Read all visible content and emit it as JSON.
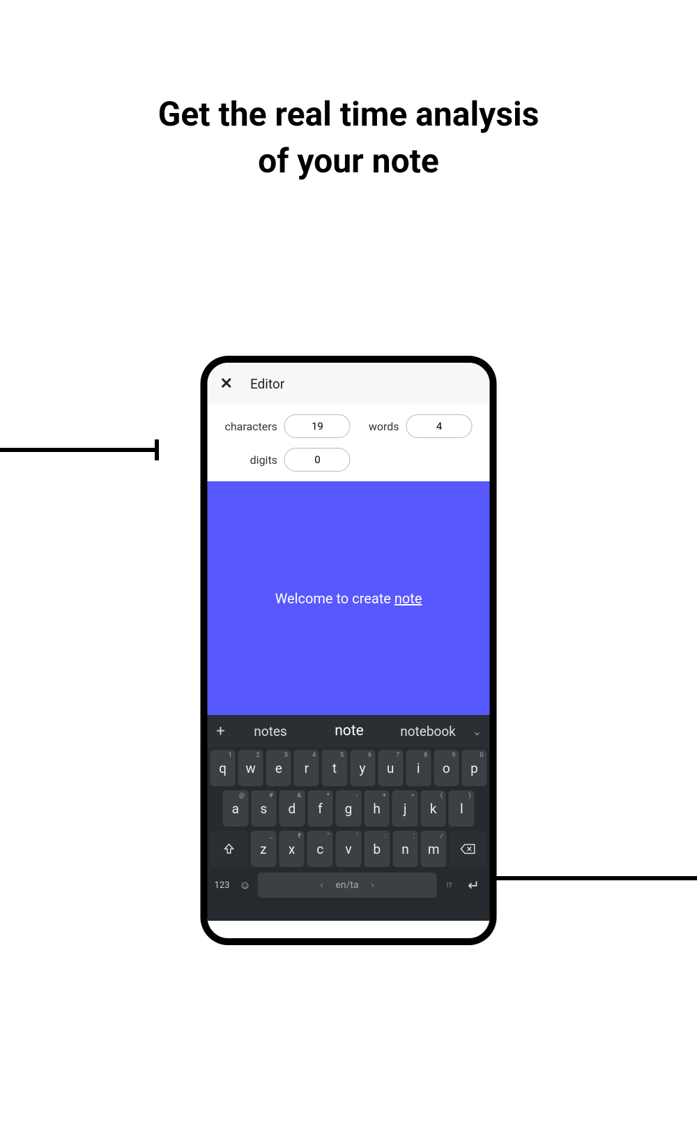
{
  "heading_line1": "Get the real time analysis",
  "heading_line2": "of your note",
  "header": {
    "title": "Editor"
  },
  "stats": {
    "characters_label": "characters",
    "characters_value": "19",
    "words_label": "words",
    "words_value": "4",
    "digits_label": "digits",
    "digits_value": "0"
  },
  "editor": {
    "text_prefix": "Welcome to create ",
    "text_underlined": "note"
  },
  "suggestions": {
    "s1": "notes",
    "s2": "note",
    "s3": "notebook"
  },
  "keys": {
    "row1_syms": [
      "1",
      "2",
      "3",
      "4",
      "5",
      "6",
      "7",
      "8",
      "9",
      "0"
    ],
    "row1": [
      "q",
      "w",
      "e",
      "r",
      "t",
      "y",
      "u",
      "i",
      "o",
      "p"
    ],
    "row2_syms": [
      "@",
      "#",
      "&",
      "*",
      "-",
      "+",
      "=",
      "(",
      ")"
    ],
    "row2": [
      "a",
      "s",
      "d",
      "f",
      "g",
      "h",
      "j",
      "k",
      "l"
    ],
    "row3_syms": [
      "_",
      "₹",
      "\"",
      "'",
      ":",
      ";",
      "/"
    ],
    "row3": [
      "z",
      "x",
      "c",
      "v",
      "b",
      "n",
      "m"
    ],
    "num": "123",
    "space": "en/ta",
    "q": "!?"
  }
}
